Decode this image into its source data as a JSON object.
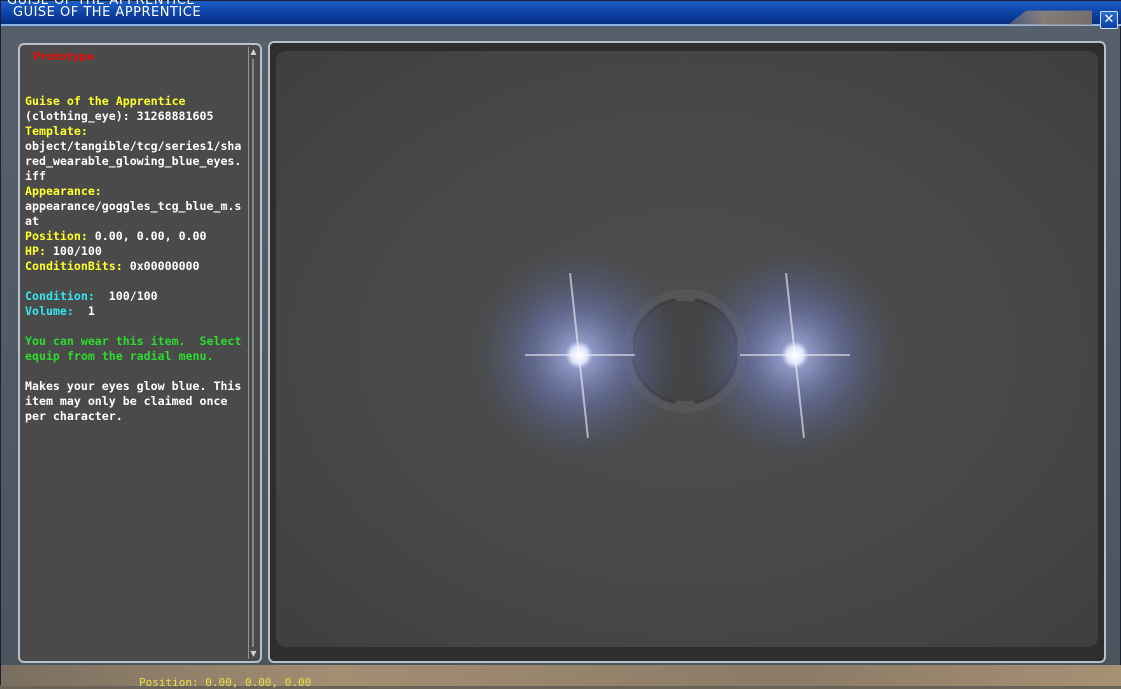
{
  "window": {
    "title": "GUISE OF THE APPRENTICE",
    "close_glyph": "✕"
  },
  "info": {
    "flag": "Prototype",
    "name": "Guise of the Apprentice",
    "type_line": "(clothing_eye): 31268881605",
    "template_label": "Template:",
    "template_value": "object/tangible/tcg/series1/shared_wearable_glowing_blue_eyes.iff",
    "appearance_label": "Appearance:",
    "appearance_value": "appearance/goggles_tcg_blue_m.sat",
    "position_label": "Position:",
    "position_value": " 0.00, 0.00, 0.00",
    "hp_label": "HP:",
    "hp_value": " 100/100",
    "condbits_label": "ConditionBits:",
    "condbits_value": " 0x00000000",
    "condition_label": "Condition:",
    "condition_value": "  100/100",
    "volume_label": "Volume:",
    "volume_value": "  1",
    "wear_text": "You can wear this item.  Select equip from the radial menu.",
    "description": "Makes your eyes glow blue. This item may only be claimed once per character."
  },
  "scroll": {
    "up": "▲",
    "down": "▼"
  },
  "footer": {
    "ghost_text": "Position:  0.00, 0.00, 0.00"
  },
  "icons": {
    "close": "close-icon",
    "scroll_up": "arrow-up-icon",
    "scroll_down": "arrow-down-icon"
  },
  "colors": {
    "label_yellow": "#ffff2a",
    "label_cyan": "#36e6ee",
    "text_green": "#2ddc2d",
    "prototype_red": "#e20f0f",
    "titlebar_blue": "#0b3ea0",
    "glow_blue": "#7f8fd9"
  }
}
